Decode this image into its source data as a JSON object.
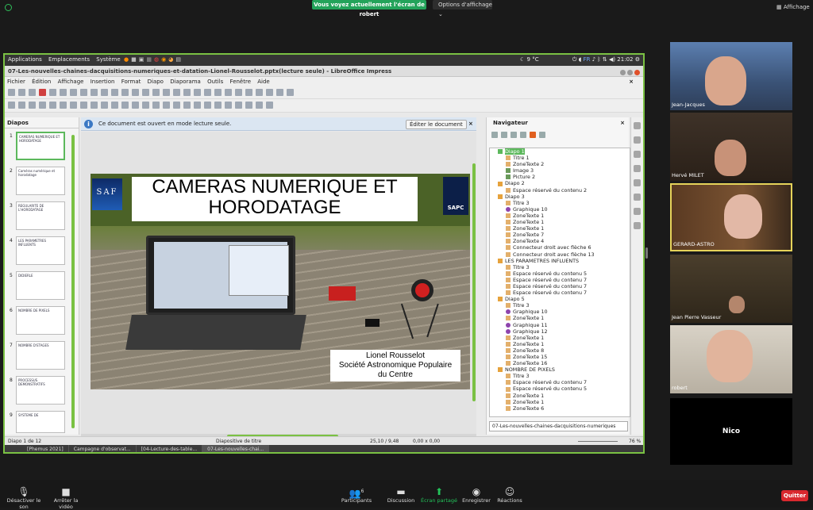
{
  "zoom_banner": {
    "sharing_text": "Vous voyez actuellement l'écran de robert",
    "view_options": "Options d'affichage",
    "layout_button": "Affichage"
  },
  "gnome": {
    "menu": [
      "Applications",
      "Emplacements",
      "Système"
    ],
    "weather": "9 °C",
    "keyboard": "FR",
    "time": "21:02"
  },
  "window_title": "07-Les-nouvelles-chaines-dacquisitions-numeriques-et-datation-Lionel-Rousselot.pptx(lecture seule) - LibreOffice Impress",
  "lo_menu": [
    "Fichier",
    "Édition",
    "Affichage",
    "Insertion",
    "Format",
    "Diapo",
    "Diaporama",
    "Outils",
    "Fenêtre",
    "Aide"
  ],
  "slides_panel": {
    "header": "Diapos",
    "thumbs": [
      {
        "num": "1",
        "text": "CAMERAS NUMERIQUE ET HORODATAGE"
      },
      {
        "num": "2",
        "text": "Caméras numérique et horodatage"
      },
      {
        "num": "3",
        "text": "REGULARITE DE L'HORODATAGE"
      },
      {
        "num": "4",
        "text": "LES PARAMETRES INFLUENTS"
      },
      {
        "num": "5",
        "text": "DIDIERLE"
      },
      {
        "num": "6",
        "text": "NOMBRE DE PIXELS"
      },
      {
        "num": "7",
        "text": "NOMBRE D'ETAGES"
      },
      {
        "num": "8",
        "text": "PROCESSUS DEMONSTRATIFS"
      },
      {
        "num": "9",
        "text": "SYSTEME DE"
      }
    ]
  },
  "readonly_bar": {
    "message": "Ce document est ouvert en mode lecture seule.",
    "edit_button": "Éditer le document",
    "info_glyph": "i",
    "close_glyph": "×"
  },
  "slide": {
    "title": "CAMERAS NUMERIQUE ET HORODATAGE",
    "logo_left": "SAF",
    "logo_right": "SAPC",
    "author_lines": [
      "Lionel Rousselot",
      "Société Astronomique Populaire",
      "du Centre"
    ]
  },
  "navigator": {
    "header": "Navigateur",
    "tree": [
      {
        "level": 0,
        "label": "Diapo 1",
        "kind": "slide",
        "highlight": true
      },
      {
        "level": 1,
        "label": "Titre 1",
        "kind": "text"
      },
      {
        "level": 1,
        "label": "ZoneTexte 2",
        "kind": "text"
      },
      {
        "level": 1,
        "label": "Image 3",
        "kind": "image"
      },
      {
        "level": 1,
        "label": "Picture 2",
        "kind": "image"
      },
      {
        "level": 0,
        "label": "Diapo 2",
        "kind": "slide"
      },
      {
        "level": 1,
        "label": "Espace réservé du contenu 2",
        "kind": "text"
      },
      {
        "level": 0,
        "label": "Diapo 3",
        "kind": "slide"
      },
      {
        "level": 1,
        "label": "Titre 3",
        "kind": "text"
      },
      {
        "level": 1,
        "label": "Graphique 10",
        "kind": "graph"
      },
      {
        "level": 1,
        "label": "ZoneTexte 1",
        "kind": "text"
      },
      {
        "level": 1,
        "label": "ZoneTexte 1",
        "kind": "text"
      },
      {
        "level": 1,
        "label": "ZoneTexte 1",
        "kind": "text"
      },
      {
        "level": 1,
        "label": "ZoneTexte 7",
        "kind": "text"
      },
      {
        "level": 1,
        "label": "ZoneTexte 4",
        "kind": "text"
      },
      {
        "level": 1,
        "label": "Connecteur droit avec flèche 6",
        "kind": "text"
      },
      {
        "level": 1,
        "label": "Connecteur droit avec flèche 13",
        "kind": "text"
      },
      {
        "level": 0,
        "label": "LES PARAMETRES INFLUENTS",
        "kind": "slide"
      },
      {
        "level": 1,
        "label": "Titre 3",
        "kind": "text"
      },
      {
        "level": 1,
        "label": "Espace réservé du contenu 5",
        "kind": "text"
      },
      {
        "level": 1,
        "label": "Espace réservé du contenu 7",
        "kind": "text"
      },
      {
        "level": 1,
        "label": "Espace réservé du contenu 7",
        "kind": "text"
      },
      {
        "level": 1,
        "label": "Espace réservé du contenu 7",
        "kind": "text"
      },
      {
        "level": 0,
        "label": "Diapo 5",
        "kind": "slide"
      },
      {
        "level": 1,
        "label": "Titre 3",
        "kind": "text"
      },
      {
        "level": 1,
        "label": "Graphique 10",
        "kind": "graph"
      },
      {
        "level": 1,
        "label": "ZoneTexte 1",
        "kind": "text"
      },
      {
        "level": 1,
        "label": "Graphique 11",
        "kind": "graph"
      },
      {
        "level": 1,
        "label": "Graphique 12",
        "kind": "graph"
      },
      {
        "level": 1,
        "label": "ZoneTexte 1",
        "kind": "text"
      },
      {
        "level": 1,
        "label": "ZoneTexte 1",
        "kind": "text"
      },
      {
        "level": 1,
        "label": "ZoneTexte 8",
        "kind": "text"
      },
      {
        "level": 1,
        "label": "ZoneTexte 15",
        "kind": "text"
      },
      {
        "level": 1,
        "label": "ZoneTexte 16",
        "kind": "text"
      },
      {
        "level": 0,
        "label": "NOMBRE DE PIXELS",
        "kind": "slide"
      },
      {
        "level": 1,
        "label": "Titre 3",
        "kind": "text"
      },
      {
        "level": 1,
        "label": "Espace réservé du contenu 7",
        "kind": "text"
      },
      {
        "level": 1,
        "label": "Espace réservé du contenu 5",
        "kind": "text"
      },
      {
        "level": 1,
        "label": "ZoneTexte 1",
        "kind": "text"
      },
      {
        "level": 1,
        "label": "ZoneTexte 1",
        "kind": "text"
      },
      {
        "level": 1,
        "label": "ZoneTexte 6",
        "kind": "text"
      }
    ],
    "document_select": "07-Les-nouvelles-chaines-dacquisitions-numeriques"
  },
  "statusbar": {
    "slide": "Diapo 1 de 12",
    "layout": "Diapositive de titre",
    "position": "25,10 / 9,48",
    "size": "0,00 x 0,00",
    "zoom": "76 %"
  },
  "taskbar": [
    "[Phemus 2021]",
    "Campagne d'observat...",
    "[04-Lecture-des-table...",
    "07-Les-nouvelles-chai..."
  ],
  "participants": [
    {
      "name": "Jean-Jacques",
      "active": false
    },
    {
      "name": "Hervé MILET",
      "active": false
    },
    {
      "name": "GERARD-ASTRO",
      "active": true
    },
    {
      "name": "Jean Pierre Vasseur",
      "active": false
    },
    {
      "name": "robert",
      "active": false
    }
  ],
  "nico_tile": "Nico",
  "controls": {
    "mute": "Désactiver le son",
    "video": "Arrêter la vidéo",
    "participants": "Participants",
    "participants_count": "6",
    "chat": "Discussion",
    "share": "Écran partagé",
    "record": "Enregistrer",
    "reactions": "Réactions",
    "quit": "Quitter"
  },
  "colors": {
    "accent_green": "#7ac143",
    "zoom_green": "#23a35a",
    "quit_red": "#d9282e",
    "active_speaker": "#e5d35a"
  }
}
